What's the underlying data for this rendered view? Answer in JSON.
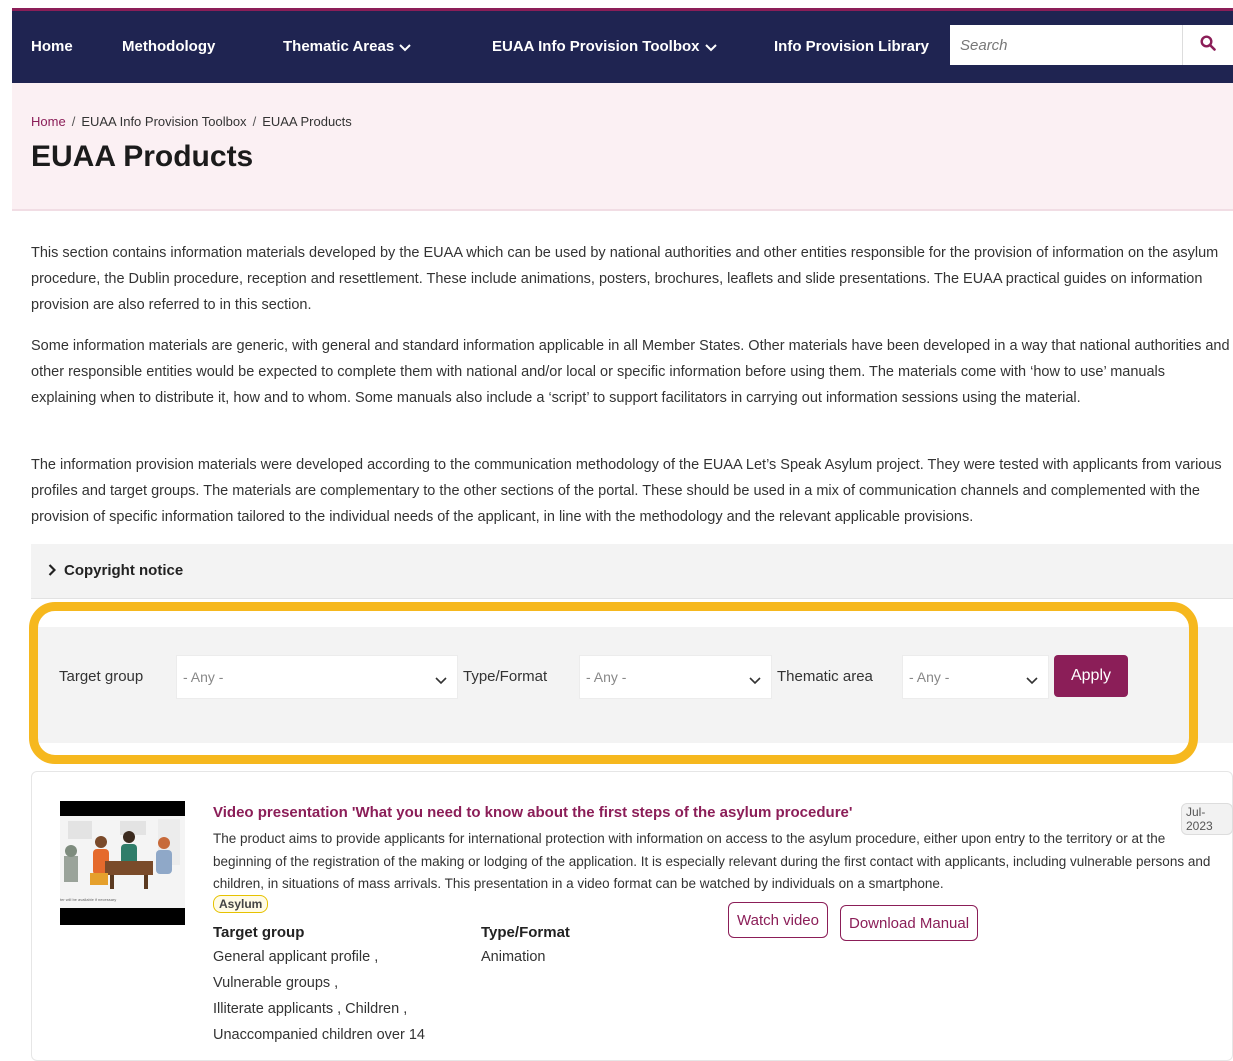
{
  "nav": {
    "items": [
      {
        "label": "Home",
        "dropdown": false
      },
      {
        "label": "Methodology",
        "dropdown": false
      },
      {
        "label": "Thematic Areas",
        "dropdown": true
      },
      {
        "label": "EUAA Info Provision Toolbox",
        "dropdown": true
      },
      {
        "label": "Info Provision Library",
        "dropdown": false
      }
    ],
    "search_placeholder": "Search"
  },
  "breadcrumb": [
    "Home",
    "EUAA Info Provision Toolbox",
    "EUAA Products"
  ],
  "page_title": "EUAA Products",
  "intro": [
    "This section contains information materials developed by the EUAA which can be used by national authorities and other entities responsible for the provision of information on the asylum procedure, the Dublin procedure, reception and resettlement. These include animations, posters, brochures, leaflets and slide presentations. The EUAA practical guides on information provision are also referred to in this section.",
    "Some information materials are generic, with general and standard information applicable in all Member States. Other materials have been developed in a way that national authorities and other responsible entities would be expected to complete them with national and/or local or specific information before using them. The materials come with ‘how to use’ manuals explaining when to distribute it, how and to whom. Some manuals also include a ‘script’ to support facilitators in carrying out information sessions using the material.",
    "The information provision materials were developed according to the communication methodology of the EUAA Let’s Speak Asylum project. They were tested with applicants from various profiles and target groups. The materials are complementary to the other sections of the portal. These should be used in a mix of communication channels and complemented with the provision of specific information tailored to the individual needs of the applicant, in line with the methodology and the relevant applicable provisions."
  ],
  "copyright": {
    "label": "Copyright notice"
  },
  "filters": {
    "target_group": {
      "label": "Target group",
      "value": "- Any -"
    },
    "type_format": {
      "label": "Type/Format",
      "value": "- Any -"
    },
    "thematic_area": {
      "label": "Thematic area",
      "value": "- Any -"
    },
    "apply_label": "Apply"
  },
  "highlight_color": "#f6b81e",
  "accent_color": "#8b1e58",
  "nav_color": "#1f2451",
  "card": {
    "title": "Video presentation 'What you need to know about the first steps of the asylum procedure'",
    "date": "Jul-2023",
    "description": "The product aims to provide applicants for international protection with information on access to the asylum procedure, either upon entry to the territory or at the beginning of the registration of the making or lodging of the application. It is especially relevant during the first contact with applicants, including vulnerable persons and children, in situations of mass arrivals. This presentation in a video format can be watched by individuals on a smartphone.",
    "tag": "Asylum",
    "thumb_caption": "ter will be available if necessary",
    "target_group_label": "Target group",
    "target_groups": [
      "General applicant profile ,",
      "Vulnerable groups ,",
      "Illiterate applicants , Children ,",
      "Unaccompanied children over 14"
    ],
    "type_format_label": "Type/Format",
    "type_format_value": "Animation",
    "watch_label": "Watch video",
    "download_label": "Download Manual"
  }
}
